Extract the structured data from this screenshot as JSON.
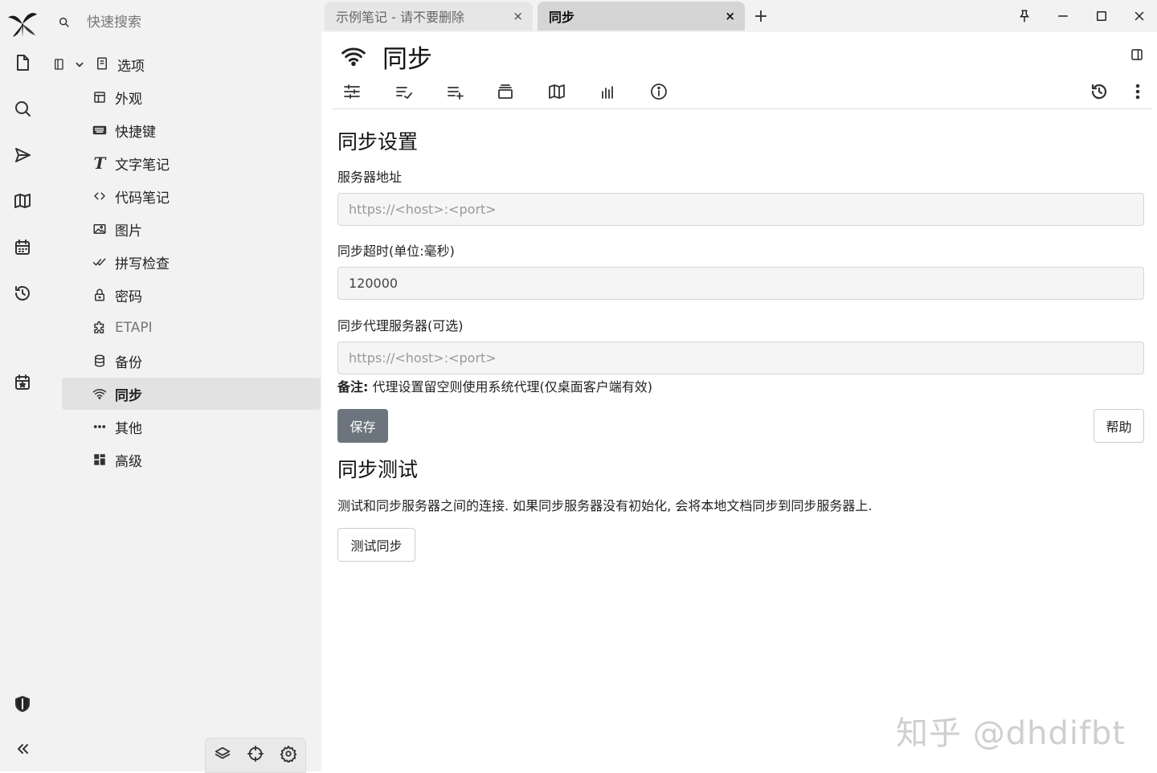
{
  "search": {
    "placeholder": "快速搜索"
  },
  "tree": {
    "root": {
      "label": "选项"
    },
    "items": [
      {
        "label": "外观",
        "icon": "layout-icon"
      },
      {
        "label": "快捷键",
        "icon": "keyboard-icon"
      },
      {
        "label": "文字笔记",
        "icon": "text-icon"
      },
      {
        "label": "代码笔记",
        "icon": "code-icon"
      },
      {
        "label": "图片",
        "icon": "image-icon"
      },
      {
        "label": "拼写检查",
        "icon": "check-double-icon"
      },
      {
        "label": "密码",
        "icon": "lock-icon"
      },
      {
        "label": "ETAPI",
        "icon": "extension-icon"
      },
      {
        "label": "备份",
        "icon": "database-icon"
      },
      {
        "label": "同步",
        "icon": "wifi-icon",
        "active": true
      },
      {
        "label": "其他",
        "icon": "dots-icon"
      },
      {
        "label": "高级",
        "icon": "grid-icon"
      }
    ]
  },
  "tabs": [
    {
      "label": "示例笔记 - 请不要删除",
      "active": false
    },
    {
      "label": "同步",
      "active": true
    }
  ],
  "tab_close_glyph": "×",
  "new_tab_glyph": "+",
  "note": {
    "title": "同步",
    "sync_settings": {
      "heading": "同步设置",
      "server_label": "服务器地址",
      "server_placeholder": "https://<host>:<port>",
      "timeout_label": "同步超时(单位:毫秒)",
      "timeout_value": "120000",
      "proxy_label": "同步代理服务器(可选)",
      "proxy_placeholder": "https://<host>:<port>",
      "note_bold": "备注:",
      "note_text": " 代理设置留空则使用系统代理(仅桌面客户端有效)",
      "save_label": "保存",
      "help_label": "帮助"
    },
    "sync_test": {
      "heading": "同步测试",
      "description": "测试和同步服务器之间的连接. 如果同步服务器没有初始化, 会将本地文档同步到同步服务器上.",
      "button_label": "测试同步"
    }
  },
  "watermark": "知乎 @dhdifbt",
  "colors": {
    "save_button": "#6c757d",
    "sidebar_bg": "#f2f2f2",
    "active_item": "#e2e2e2"
  }
}
